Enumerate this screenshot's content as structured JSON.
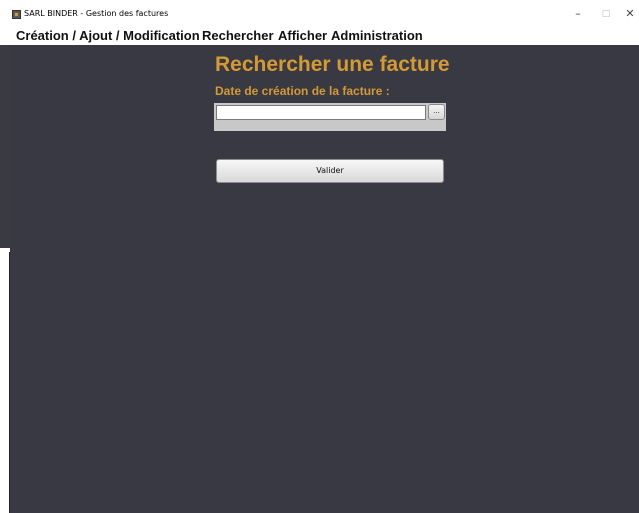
{
  "window": {
    "title": "SARL BINDER - Gestion des factures",
    "minimize_glyph": "–",
    "maximize_glyph": "□",
    "close_glyph": "✕"
  },
  "menu": {
    "items": [
      {
        "label": "Création / Ajout / Modification"
      },
      {
        "label": "Rechercher"
      },
      {
        "label": "Afficher"
      },
      {
        "label": "Administration"
      }
    ]
  },
  "form": {
    "heading": "Rechercher une facture",
    "date_label": "Date de création de la facture :",
    "date_value": "",
    "date_picker_label": "...",
    "submit_label": "Valider"
  },
  "colors": {
    "background": "#393943",
    "accent": "#d49a35"
  },
  "icons": {
    "app": "app-icon"
  }
}
